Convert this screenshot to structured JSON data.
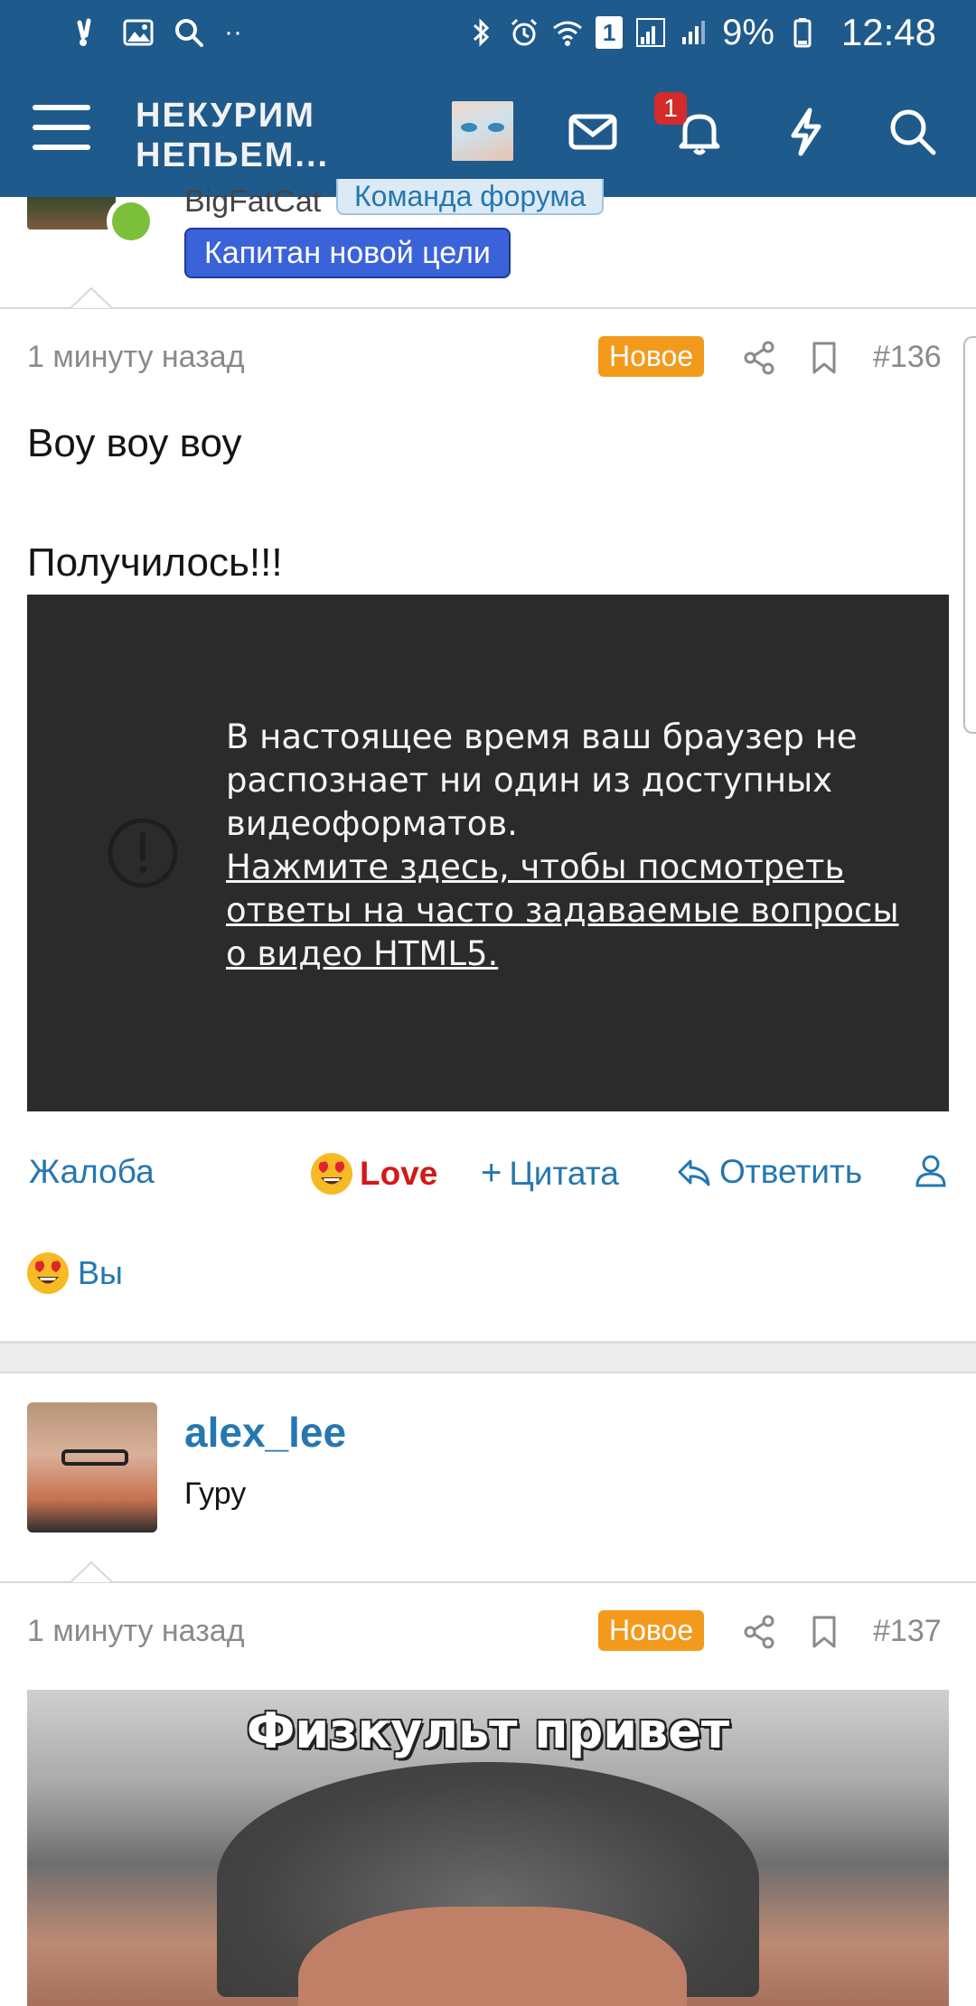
{
  "status_bar": {
    "battery_percent": "9%",
    "time": "12:48",
    "sim_number": "1"
  },
  "header": {
    "logo_line1": "НЕКУРИМ",
    "logo_line2": "НЕПЬЕМ...",
    "notification_count": "1",
    "icons": [
      "menu-icon",
      "avatar",
      "mail-icon",
      "bell-icon",
      "lightning-icon",
      "search-icon"
    ]
  },
  "prev_post": {
    "username_partial": "BigFatCat",
    "banner": "Команда форума",
    "badge": "Капитан новой цели"
  },
  "post_136": {
    "time": "1 минуту назад",
    "new_label": "Новое",
    "number": "#136",
    "text_line1": "Воу воу воу",
    "text_line2": "Получилось!!!",
    "video_message": "В настоящее время ваш браузер не распознает ни один из доступных видеоформатов.",
    "video_link": "Нажмите здесь, чтобы посмотреть ответы на часто задаваемые вопросы о видео HTML5.",
    "actions": {
      "report": "Жалоба",
      "love": "Love",
      "quote": "Цитата",
      "reply": "Ответить"
    },
    "reactions_label": "Вы"
  },
  "post_137": {
    "username": "alex_lee",
    "user_title": "Гуру",
    "time": "1 минуту назад",
    "new_label": "Новое",
    "number": "#137",
    "image_caption": "Физкульт привет"
  },
  "colors": {
    "brand": "#1f5a8c",
    "link": "#2577b1",
    "new_badge": "#f39a1d",
    "love": "#d11a1a",
    "captain_badge": "#3b63d9"
  }
}
